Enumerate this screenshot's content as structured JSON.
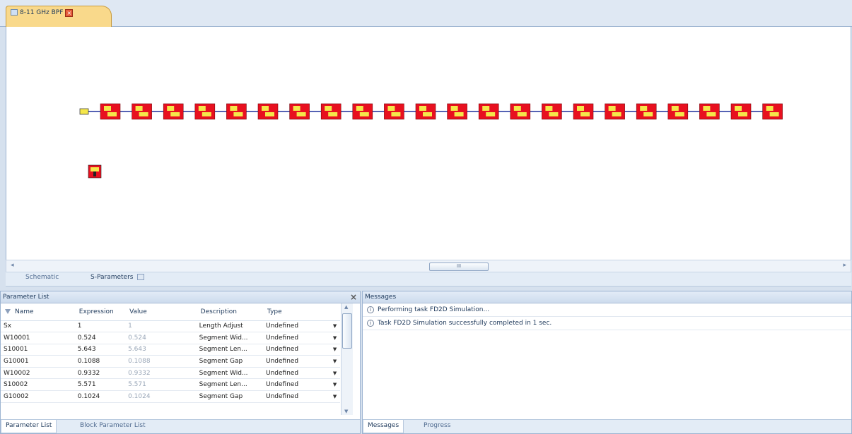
{
  "document_tab": {
    "label": "8-11 GHz BPF"
  },
  "canvas": {
    "scroll_thumb_label": "III",
    "colors": {
      "block_fill": "#e8101f",
      "block_pattern": "#f5e74a",
      "line": "#1d2f9c"
    }
  },
  "view_tabs": {
    "schematic": "Schematic",
    "sparams": "S-Parameters"
  },
  "parameter_panel": {
    "title": "Parameter List",
    "columns": [
      "Name",
      "Expression",
      "Value",
      "Description",
      "Type"
    ],
    "rows": [
      {
        "name": "Sx",
        "expr": "1",
        "value": "1",
        "desc": "Length Adjust",
        "type": "Undefined"
      },
      {
        "name": "W10001",
        "expr": "0.524",
        "value": "0.524",
        "desc": "Segment Wid...",
        "type": "Undefined"
      },
      {
        "name": "S10001",
        "expr": "5.643",
        "value": "5.643",
        "desc": "Segment Len...",
        "type": "Undefined"
      },
      {
        "name": "G10001",
        "expr": "0.1088",
        "value": "0.1088",
        "desc": "Segment Gap",
        "type": "Undefined"
      },
      {
        "name": "W10002",
        "expr": "0.9332",
        "value": "0.9332",
        "desc": "Segment Wid...",
        "type": "Undefined"
      },
      {
        "name": "S10002",
        "expr": "5.571",
        "value": "5.571",
        "desc": "Segment Len...",
        "type": "Undefined"
      },
      {
        "name": "G10002",
        "expr": "0.1024",
        "value": "0.1024",
        "desc": "Segment Gap",
        "type": "Undefined"
      }
    ],
    "tabs": [
      "Parameter List",
      "Block Parameter List"
    ]
  },
  "messages_panel": {
    "title": "Messages",
    "lines": [
      "Performing task FD2D Simulation...",
      "Task FD2D Simulation successfully completed in 1 sec."
    ],
    "tabs": [
      "Messages",
      "Progress"
    ]
  }
}
